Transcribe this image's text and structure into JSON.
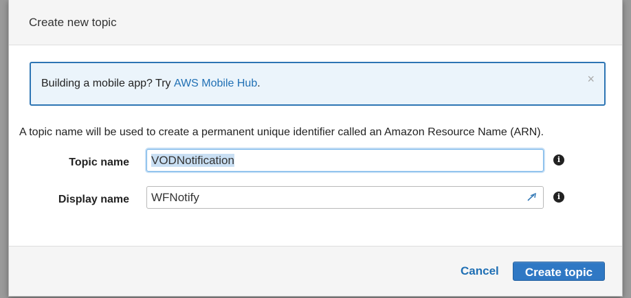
{
  "modal": {
    "title": "Create new topic",
    "alert": {
      "text_prefix": "Building a mobile app? Try ",
      "link_text": "AWS Mobile Hub",
      "text_suffix": ".",
      "close_glyph": "×"
    },
    "description": "A topic name will be used to create a permanent unique identifier called an Amazon Resource Name (ARN).",
    "fields": {
      "topic_name": {
        "label": "Topic name",
        "value": "VODNotification"
      },
      "display_name": {
        "label": "Display name",
        "value": "WFNotify"
      }
    },
    "buttons": {
      "cancel": "Cancel",
      "create": "Create topic"
    }
  },
  "icons": {
    "info": "info-icon",
    "close": "close-icon",
    "field_tool": "input-helper-icon"
  },
  "colors": {
    "accent": "#2f78c4",
    "link": "#1f6fb4",
    "alert_border": "#2c74b3",
    "alert_bg": "#ebf4fb"
  }
}
